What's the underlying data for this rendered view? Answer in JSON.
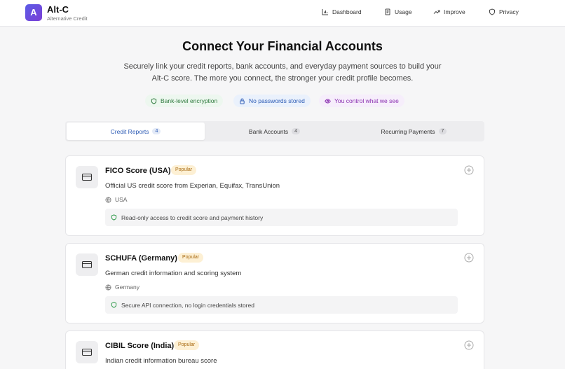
{
  "header": {
    "logo_letter": "A",
    "brand_name": "Alt-C",
    "brand_sub": "Alternative Credit",
    "nav": [
      {
        "label": "Dashboard",
        "icon": "bar-chart-icon"
      },
      {
        "label": "Usage",
        "icon": "receipt-icon"
      },
      {
        "label": "Improve",
        "icon": "trending-up-icon"
      },
      {
        "label": "Privacy",
        "icon": "shield-icon"
      }
    ]
  },
  "hero": {
    "title": "Connect Your Financial Accounts",
    "subtitle": "Securely link your credit reports, bank accounts, and everyday payment sources to build your Alt-C score. The more you connect, the stronger your credit profile becomes.",
    "badges": [
      {
        "label": "Bank-level encryption",
        "icon": "shield-icon",
        "color": "#2f7a3e"
      },
      {
        "label": "No passwords stored",
        "icon": "lock-icon",
        "color": "#2c5bb5"
      },
      {
        "label": "You control what we see",
        "icon": "eye-icon",
        "color": "#8a2fb0"
      }
    ]
  },
  "tabs": [
    {
      "label": "Credit Reports",
      "count": "4",
      "active": true
    },
    {
      "label": "Bank Accounts",
      "count": "4",
      "active": false
    },
    {
      "label": "Recurring Payments",
      "count": "7",
      "active": false
    }
  ],
  "cards": [
    {
      "title": "FICO Score (USA)",
      "badge": "Popular",
      "description": "Official US credit score from Experian, Equifax, TransUnion",
      "region": "USA",
      "note": "Read-only access to credit score and payment history"
    },
    {
      "title": "SCHUFA (Germany)",
      "badge": "Popular",
      "description": "German credit information and scoring system",
      "region": "Germany",
      "note": "Secure API connection, no login credentials stored"
    },
    {
      "title": "CIBIL Score (India)",
      "badge": "Popular",
      "description": "Indian credit information bureau score",
      "region": "",
      "note": ""
    }
  ],
  "colors": {
    "accent": "#2c5bb5",
    "logo_gradient_start": "#5b5ce6",
    "logo_gradient_end": "#7b3fd6",
    "popular_bg": "#fdf0d4",
    "popular_text": "#a86a12"
  }
}
